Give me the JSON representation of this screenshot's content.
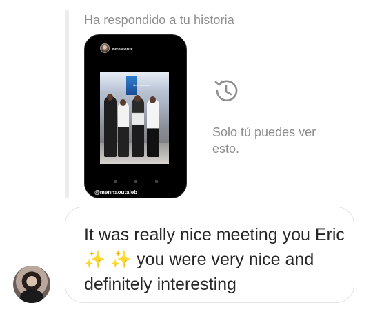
{
  "reply_header": {
    "label": "Ha respondido a tu historia"
  },
  "story": {
    "username": "mennaoutaleb",
    "mention": "@mennaoutaleb",
    "overlay_tag": "@mennaoutaleb"
  },
  "privacy_note": {
    "icon": "history-icon",
    "text": "Solo tú puedes ver esto."
  },
  "message": {
    "text": "It was really nice meeting you Eric ✨ ✨ you were very nice and definitely interesting"
  },
  "colors": {
    "secondary_text": "#8e8e8e",
    "primary_text": "#262626",
    "bubble_border": "#e3e3e3",
    "story_background": "#000000"
  }
}
